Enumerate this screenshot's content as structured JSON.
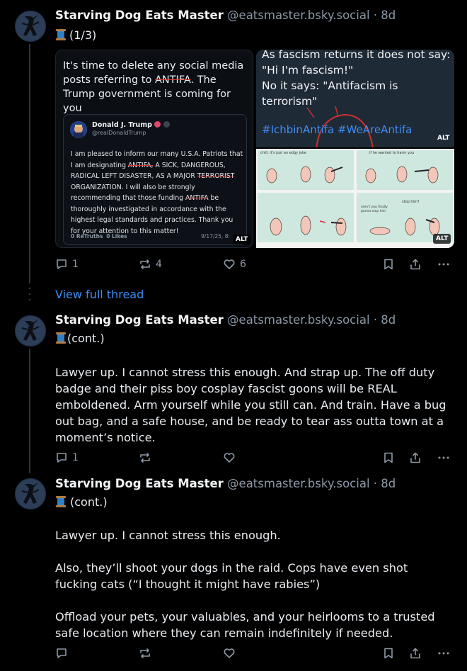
{
  "posts": [
    {
      "name": "Starving Dog Eats Master",
      "handle": "@eatsmaster.bsky.social",
      "time": "8d",
      "tag": "(1/3)",
      "replies": "1",
      "reposts": "4",
      "likes": "6",
      "media": {
        "img1": {
          "header_text_partial": "It's time to delete any social media posts referring to ",
          "struck_word": "ANTIFA",
          "header_text_rest": ". The Trump government is coming for you",
          "card": {
            "author": "Donald J. Trump",
            "author_handle": "@realDonaldTrump",
            "text_a": "I am pleased to inform our many U.S.A. Patriots that I am designating ",
            "struck_a": "ANTIFA,",
            "text_b": " A SICK, DANGEROUS, RADICAL LEFT DISASTER, AS A MAJOR ",
            "struck_b": "TERRORIST",
            "text_c": " ORGANIZATION. I will also be strongly recommending that those funding ",
            "struck_c": "ANTIFA",
            "text_d": " be thoroughly investigated in accordance with the highest legal standards and practices. Thank you for your attention to this matter!",
            "retruths": "0 ReTruths",
            "likes": "0 Likes",
            "date": "9/17/25, 8:"
          },
          "alt": "ALT"
        },
        "img2": {
          "text": "As fascism returns it does not say: \"Hi I'm fascism!\"\nNo it says: \"Antifacism is terrorism\"",
          "hashtags": "#IchbinAntifa #WeAreAntifa",
          "alt": "ALT"
        },
        "img3": {
          "panel_1_caption": "chill, it's just an edgy joke",
          "panel_2_caption": "if he wanted to harm you",
          "panel_4_caption_a": "aren't you finally gonna stop him",
          "panel_4_caption_b": "stop him?",
          "alt": "ALT"
        }
      }
    },
    {
      "name": "Starving Dog Eats Master",
      "handle": "@eatsmaster.bsky.social",
      "time": "8d",
      "tag": "(cont.)",
      "text": "Lawyer up. I cannot stress this enough. And strap up. The off duty badge and their piss boy cosplay fascist goons will be REAL emboldened. Arm yourself while you still can. And train. Have a bug out bag, and a safe house, and be ready to tear ass outta town at a moment’s notice.",
      "replies": "1",
      "reposts": "",
      "likes": ""
    },
    {
      "name": "Starving Dog Eats Master",
      "handle": "@eatsmaster.bsky.social",
      "time": "8d",
      "tag": "(cont.)",
      "text": "Lawyer up. I cannot stress this enough.\n\nAlso, they’ll shoot your dogs in the raid. Cops have even shot fucking cats (“I thought it might have rabies”)\n\nOffload your pets, your valuables, and your heirlooms to a trusted safe location where they can remain indefinitely if needed.",
      "replies": "",
      "reposts": "",
      "likes": ""
    }
  ],
  "view_full_thread": "View full thread",
  "separator": " · ",
  "colors": {
    "background": "#000000",
    "link": "#3d8df5",
    "muted": "#8c98a6",
    "line": "#2b3540"
  },
  "icons": [
    "avatar-image",
    "spool-emoji",
    "reply-icon",
    "repost-icon",
    "like-icon",
    "bookmark-icon",
    "share-icon",
    "more-icon"
  ]
}
